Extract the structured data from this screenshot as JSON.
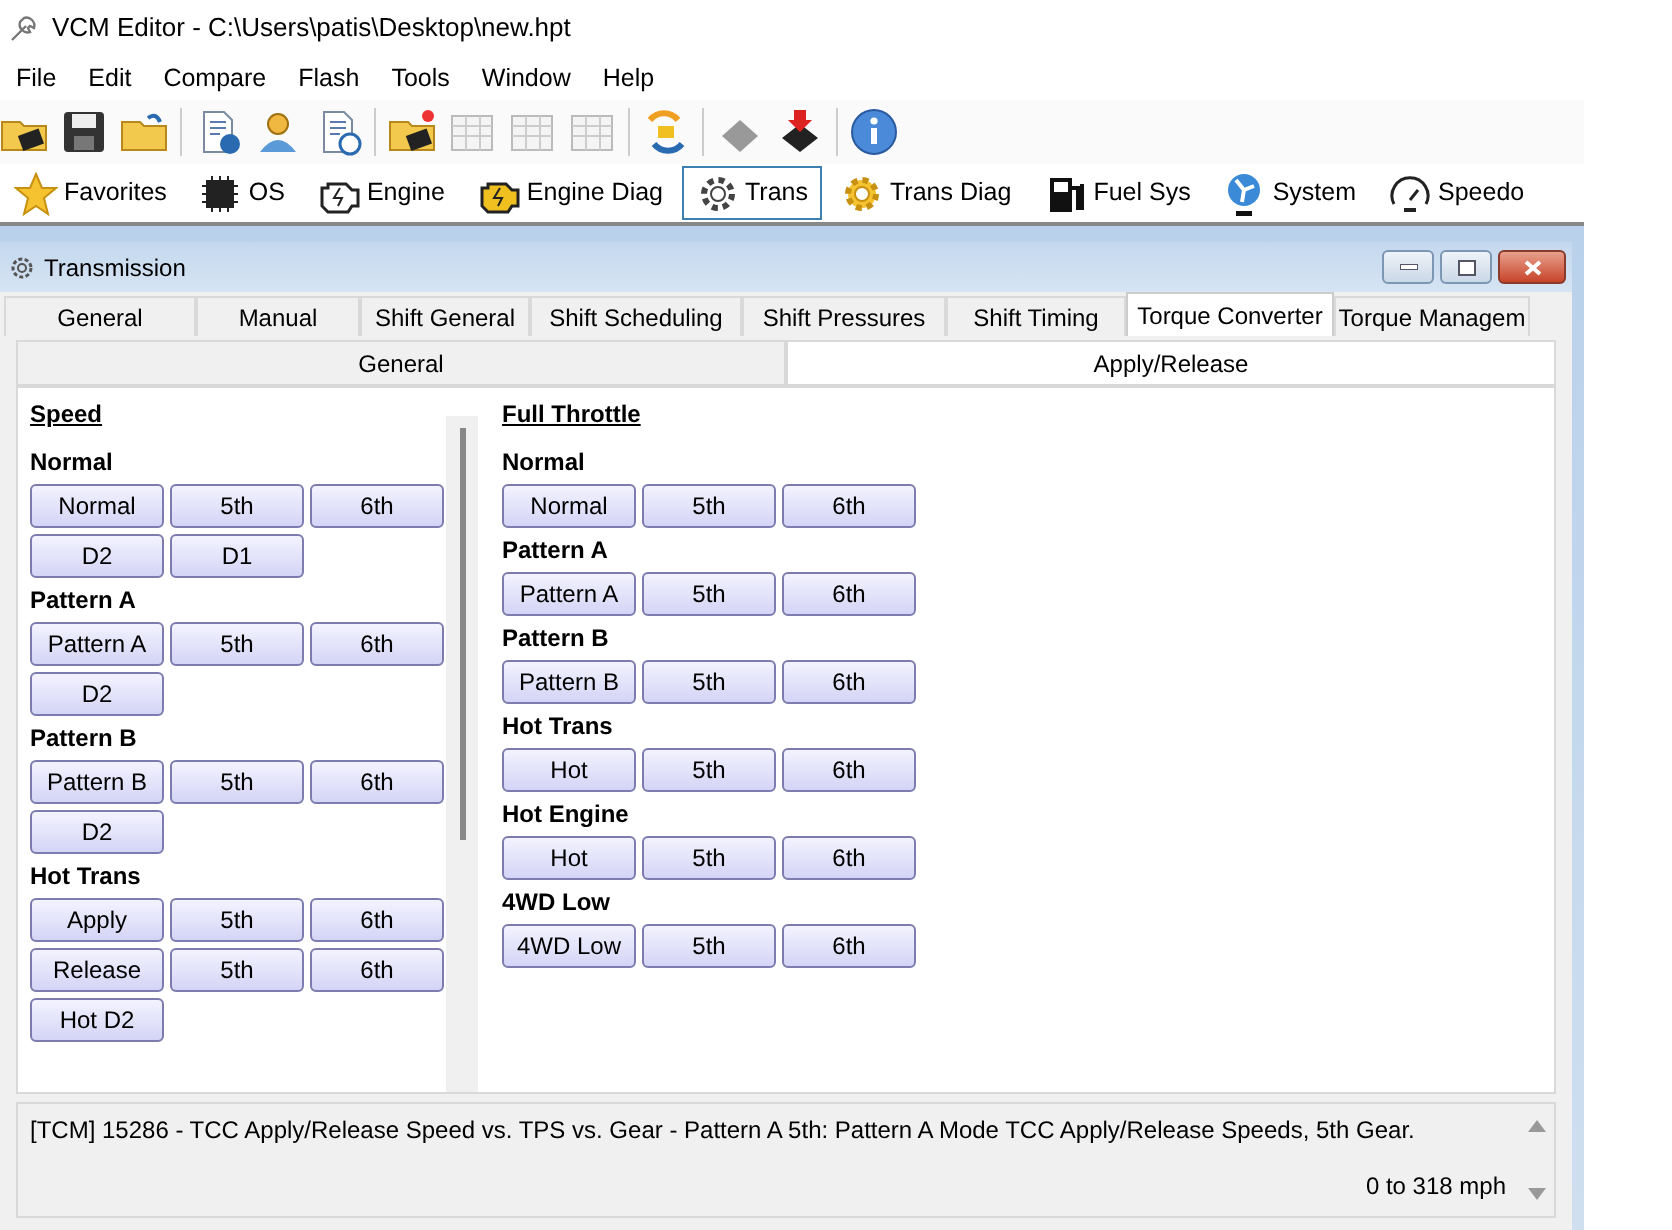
{
  "window": {
    "title": "VCM Editor - C:\\Users\\patis\\Desktop\\new.hpt"
  },
  "menu": [
    "File",
    "Edit",
    "Compare",
    "Flash",
    "Tools",
    "Window",
    "Help"
  ],
  "nav": [
    {
      "label": "Favorites",
      "selected": false
    },
    {
      "label": "OS",
      "selected": false
    },
    {
      "label": "Engine",
      "selected": false
    },
    {
      "label": "Engine Diag",
      "selected": false
    },
    {
      "label": "Trans",
      "selected": true
    },
    {
      "label": "Trans Diag",
      "selected": false
    },
    {
      "label": "Fuel Sys",
      "selected": false
    },
    {
      "label": "System",
      "selected": false
    },
    {
      "label": "Speedo",
      "selected": false
    }
  ],
  "child_window": {
    "title": "Transmission"
  },
  "tabs": [
    {
      "label": "General",
      "selected": false
    },
    {
      "label": "Manual",
      "selected": false
    },
    {
      "label": "Shift General",
      "selected": false
    },
    {
      "label": "Shift Scheduling",
      "selected": false
    },
    {
      "label": "Shift Pressures",
      "selected": false
    },
    {
      "label": "Shift Timing",
      "selected": false
    },
    {
      "label": "Torque Converter",
      "selected": true
    },
    {
      "label": "Torque Managem",
      "selected": false
    }
  ],
  "subtabs": [
    {
      "label": "General",
      "selected": false
    },
    {
      "label": "Apply/Release",
      "selected": true
    }
  ],
  "panels": [
    {
      "heading": "Speed",
      "groups": [
        {
          "title": "Normal",
          "rows": [
            [
              "Normal",
              "5th",
              "6th"
            ],
            [
              "D2",
              "D1"
            ]
          ]
        },
        {
          "title": "Pattern A",
          "rows": [
            [
              "Pattern A",
              "5th",
              "6th"
            ],
            [
              "D2"
            ]
          ]
        },
        {
          "title": "Pattern B",
          "rows": [
            [
              "Pattern B",
              "5th",
              "6th"
            ],
            [
              "D2"
            ]
          ]
        },
        {
          "title": "Hot Trans",
          "rows": [
            [
              "Apply",
              "5th",
              "6th"
            ],
            [
              "Release",
              "5th",
              "6th"
            ],
            [
              "Hot D2"
            ]
          ]
        }
      ]
    },
    {
      "heading": "Full Throttle",
      "groups": [
        {
          "title": "Normal",
          "rows": [
            [
              "Normal",
              "5th",
              "6th"
            ]
          ]
        },
        {
          "title": "Pattern A",
          "rows": [
            [
              "Pattern A",
              "5th",
              "6th"
            ]
          ]
        },
        {
          "title": "Pattern B",
          "rows": [
            [
              "Pattern B",
              "5th",
              "6th"
            ]
          ]
        },
        {
          "title": "Hot Trans",
          "rows": [
            [
              "Hot",
              "5th",
              "6th"
            ]
          ]
        },
        {
          "title": "Hot Engine",
          "rows": [
            [
              "Hot",
              "5th",
              "6th"
            ]
          ]
        },
        {
          "title": "4WD Low",
          "rows": [
            [
              "4WD Low",
              "5th",
              "6th"
            ]
          ]
        }
      ]
    }
  ],
  "status": {
    "description": "[TCM] 15286 - TCC Apply/Release Speed vs. TPS vs. Gear - Pattern A 5th: Pattern A Mode TCC Apply/Release Speeds, 5th Gear.",
    "range": "0 to 318 mph"
  }
}
